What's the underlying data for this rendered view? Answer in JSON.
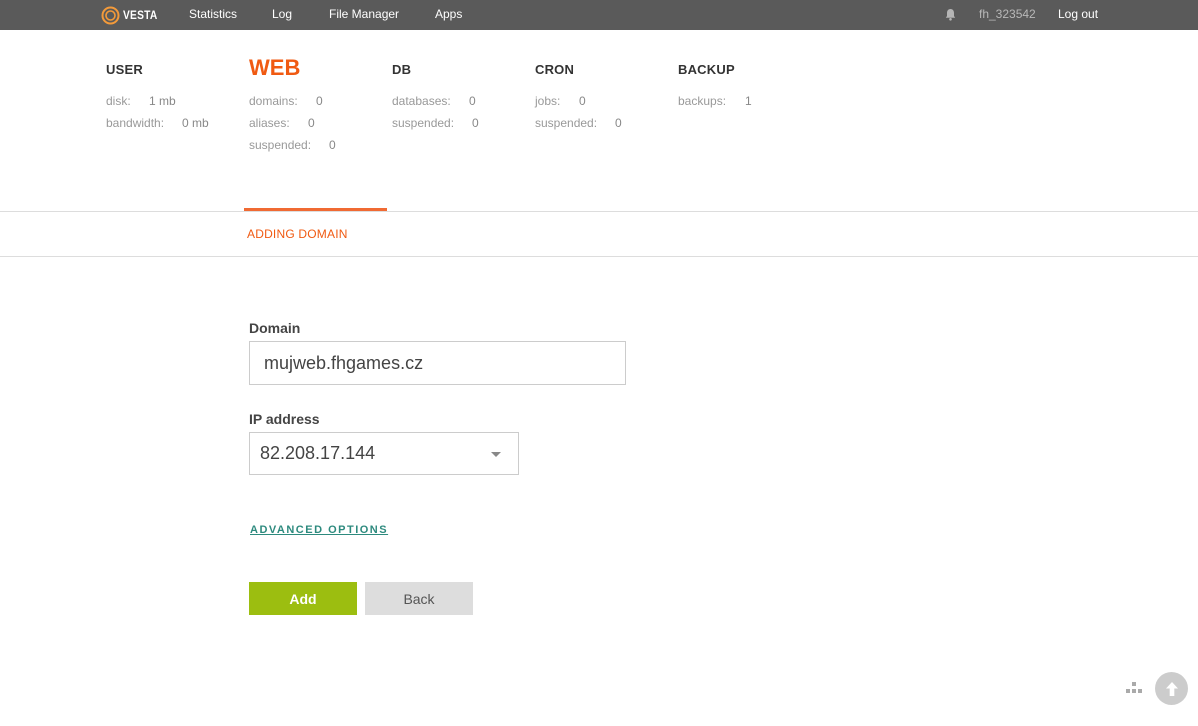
{
  "topbar": {
    "brand": "VESTA",
    "nav": [
      {
        "id": "statistics",
        "label": "Statistics"
      },
      {
        "id": "log",
        "label": "Log"
      },
      {
        "id": "file-manager",
        "label": "File Manager"
      },
      {
        "id": "apps",
        "label": "Apps"
      }
    ],
    "icons": {
      "notifications": "bell-icon"
    },
    "username": "fh_323542",
    "logout": "Log out"
  },
  "tabs": {
    "user": {
      "title": "USER",
      "stats": [
        {
          "label": "disk:",
          "value": "1 mb"
        },
        {
          "label": "bandwidth:",
          "value": "0 mb"
        }
      ]
    },
    "web": {
      "title": "WEB",
      "active": true,
      "stats": [
        {
          "label": "domains:",
          "value": "0"
        },
        {
          "label": "aliases:",
          "value": "0"
        },
        {
          "label": "suspended:",
          "value": "0"
        }
      ]
    },
    "db": {
      "title": "DB",
      "stats": [
        {
          "label": "databases:",
          "value": "0"
        },
        {
          "label": "suspended:",
          "value": "0"
        }
      ]
    },
    "cron": {
      "title": "CRON",
      "stats": [
        {
          "label": "jobs:",
          "value": "0"
        },
        {
          "label": "suspended:",
          "value": "0"
        }
      ]
    },
    "backup": {
      "title": "BACKUP",
      "stats": [
        {
          "label": "backups:",
          "value": "1"
        }
      ]
    }
  },
  "page": {
    "subtitle": "ADDING DOMAIN"
  },
  "form": {
    "domain_label": "Domain",
    "domain_value": "mujweb.fhgames.cz",
    "ip_label": "IP address",
    "ip_value": "82.208.17.144",
    "advanced_options": "ADVANCED OPTIONS",
    "add_button": "Add",
    "back_button": "Back"
  },
  "colors": {
    "topbar_bg": "#5a5a5a",
    "accent_orange": "#f05a12",
    "add_green": "#9cbe10",
    "link_teal": "#2d8a7e"
  }
}
